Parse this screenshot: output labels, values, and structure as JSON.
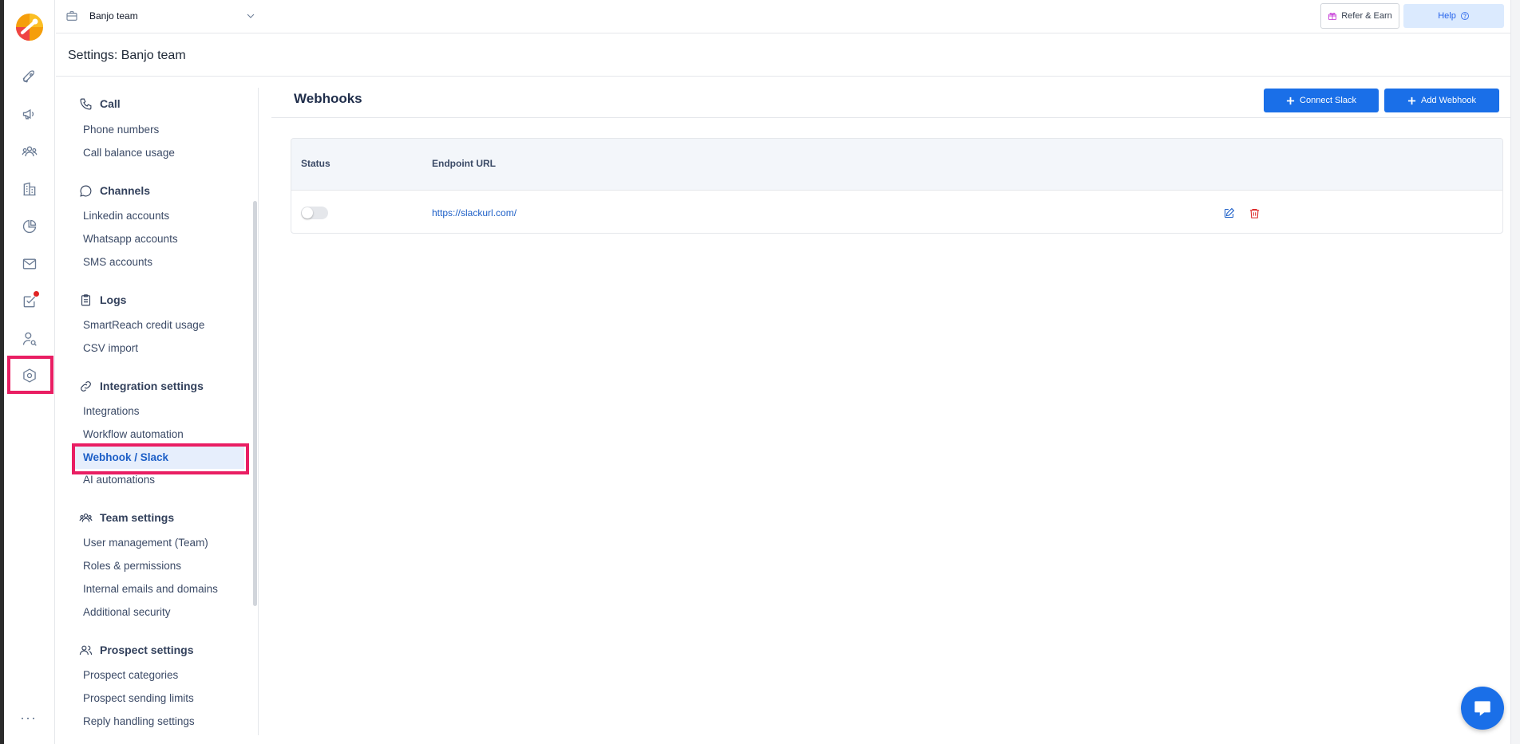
{
  "topbar": {
    "team_name": "Banjo team",
    "refer_label": "Refer & Earn",
    "help_label": "Help"
  },
  "settings_header": {
    "title": "Settings: Banjo team"
  },
  "sidenav": {
    "groups": [
      {
        "title": "Call",
        "icon": "phone-icon",
        "items": [
          "Phone numbers",
          "Call balance usage"
        ]
      },
      {
        "title": "Channels",
        "icon": "chat-bubble-icon",
        "items": [
          "Linkedin accounts",
          "Whatsapp accounts",
          "SMS accounts"
        ]
      },
      {
        "title": "Logs",
        "icon": "clipboard-icon",
        "items": [
          "SmartReach credit usage",
          "CSV import"
        ]
      },
      {
        "title": "Integration settings",
        "icon": "link-icon",
        "items": [
          "Integrations",
          "Workflow automation",
          "Webhook / Slack",
          "AI automations"
        ]
      },
      {
        "title": "Team settings",
        "icon": "team-icon",
        "items": [
          "User management (Team)",
          "Roles & permissions",
          "Internal emails and domains",
          "Additional security"
        ]
      },
      {
        "title": "Prospect settings",
        "icon": "users-icon",
        "items": [
          "Prospect categories",
          "Prospect sending limits",
          "Reply handling settings"
        ]
      }
    ],
    "active_item": "Webhook / Slack"
  },
  "main": {
    "title": "Webhooks",
    "connect_slack_label": "Connect Slack",
    "add_webhook_label": "Add Webhook",
    "table": {
      "columns": [
        "Status",
        "Endpoint URL"
      ],
      "rows": [
        {
          "status_on": false,
          "endpoint": "https://slackurl.com/"
        }
      ]
    }
  },
  "rail": {
    "icons": [
      "rocket-icon",
      "megaphone-icon",
      "people-icon",
      "building-icon",
      "pie-chart-icon",
      "mail-icon",
      "task-check-icon",
      "user-search-icon",
      "settings-hex-icon"
    ],
    "active": "settings-hex-icon",
    "notification_on": "task-check-icon"
  },
  "colors": {
    "primary": "#1a6fe8",
    "highlight": "#e91e63",
    "active_nav_bg": "#e6eefc",
    "delete": "#dc2626"
  }
}
